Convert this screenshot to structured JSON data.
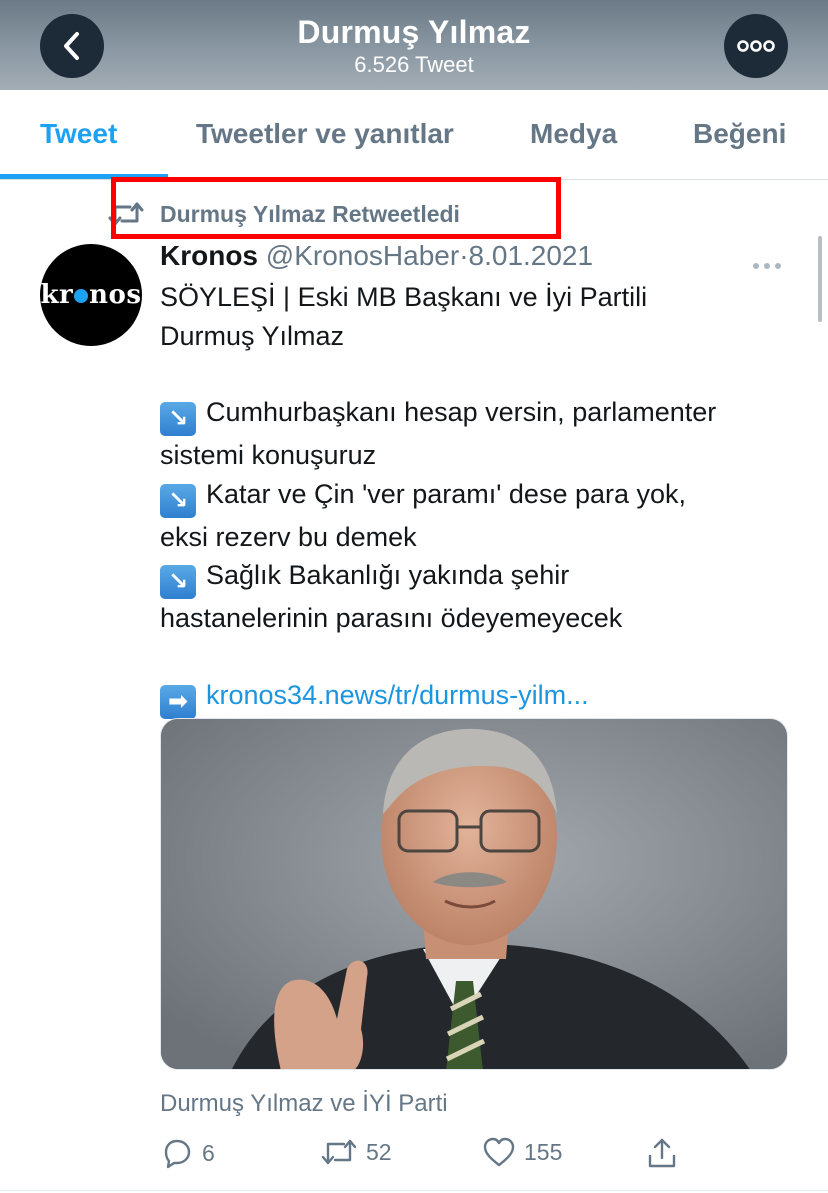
{
  "header": {
    "title": "Durmuş Yılmaz",
    "subtitle": "6.526 Tweet",
    "back_icon": "chevron-left-icon",
    "more_icon": "more-horizontal-icon"
  },
  "tabs": [
    {
      "label": "Tweet",
      "active": true
    },
    {
      "label": "Tweetler ve yanıtlar",
      "active": false
    },
    {
      "label": "Medya",
      "active": false
    },
    {
      "label": "Beğeni",
      "active": false
    }
  ],
  "retweet_context": {
    "icon": "retweet-icon",
    "label": "Durmuş Yılmaz Retweetledi",
    "highlight_color": "#ff0000"
  },
  "tweet": {
    "avatar_text": {
      "before": "kr",
      "after": "nos"
    },
    "author_name": "Kronos",
    "author_handle": "@KronosHaber",
    "separator": "·",
    "date": "8.01.2021",
    "menu_icon": "more-icon",
    "text": {
      "title_line1": "SÖYLEŞİ | Eski MB Başkanı ve İyi Partili",
      "title_line2": "Durmuş Yılmaz",
      "bullets": [
        {
          "emoji": "↘",
          "line1": "Cumhurbaşkanı hesap versin, parlamenter",
          "line2": "sistemi konuşuruz"
        },
        {
          "emoji": "↘",
          "line1": "Katar ve Çin 'ver paramı' dese para yok,",
          "line2": "eksi rezerv bu demek"
        },
        {
          "emoji": "↘",
          "line1": "Sağlık Bakanlığı yakında şehir",
          "line2": "hastanelerinin parasını ödeyemeyecek"
        }
      ],
      "link_emoji": "➡",
      "link": "kronos34.news/tr/durmus-yilm..."
    },
    "image_caption": "Durmuş Yılmaz ve İYİ Parti",
    "actions": {
      "reply_count": "6",
      "retweet_count": "52",
      "like_count": "155",
      "share_icon": "share-icon"
    }
  },
  "colors": {
    "accent": "#1da1f2",
    "link": "#1b95e0",
    "muted": "#657786",
    "header_dark": "#1d2b38"
  }
}
